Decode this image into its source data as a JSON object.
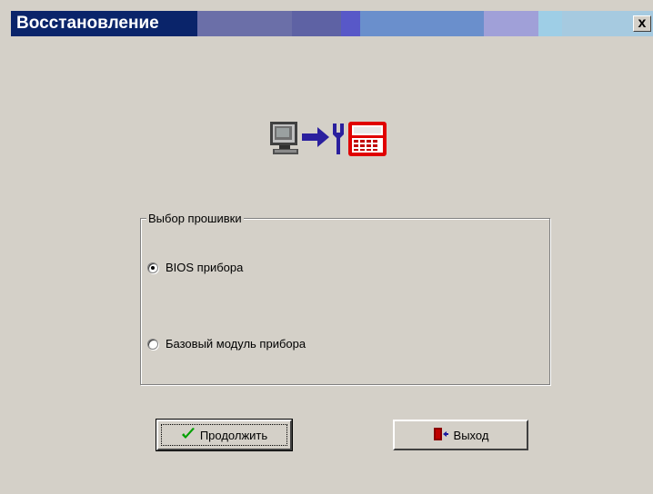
{
  "window": {
    "title": "Восстановление",
    "close_label": "x",
    "title_gradient_colors": [
      "#0a246a",
      "#6b6fa8",
      "#5858a8",
      "#6a8fcc",
      "#a0a0d8",
      "#a6cae0",
      "#9ecee6"
    ]
  },
  "hero": {
    "icons": [
      "computer-icon",
      "arrow-right-icon",
      "wrench-icon",
      "device-icon"
    ]
  },
  "firmware_group": {
    "label": "Выбор прошивки",
    "options": [
      {
        "label": "BIOS прибора",
        "checked": true
      },
      {
        "label": "Базовый модуль прибора",
        "checked": false
      }
    ]
  },
  "buttons": {
    "continue_label": "Продолжить",
    "exit_label": "Выход"
  }
}
